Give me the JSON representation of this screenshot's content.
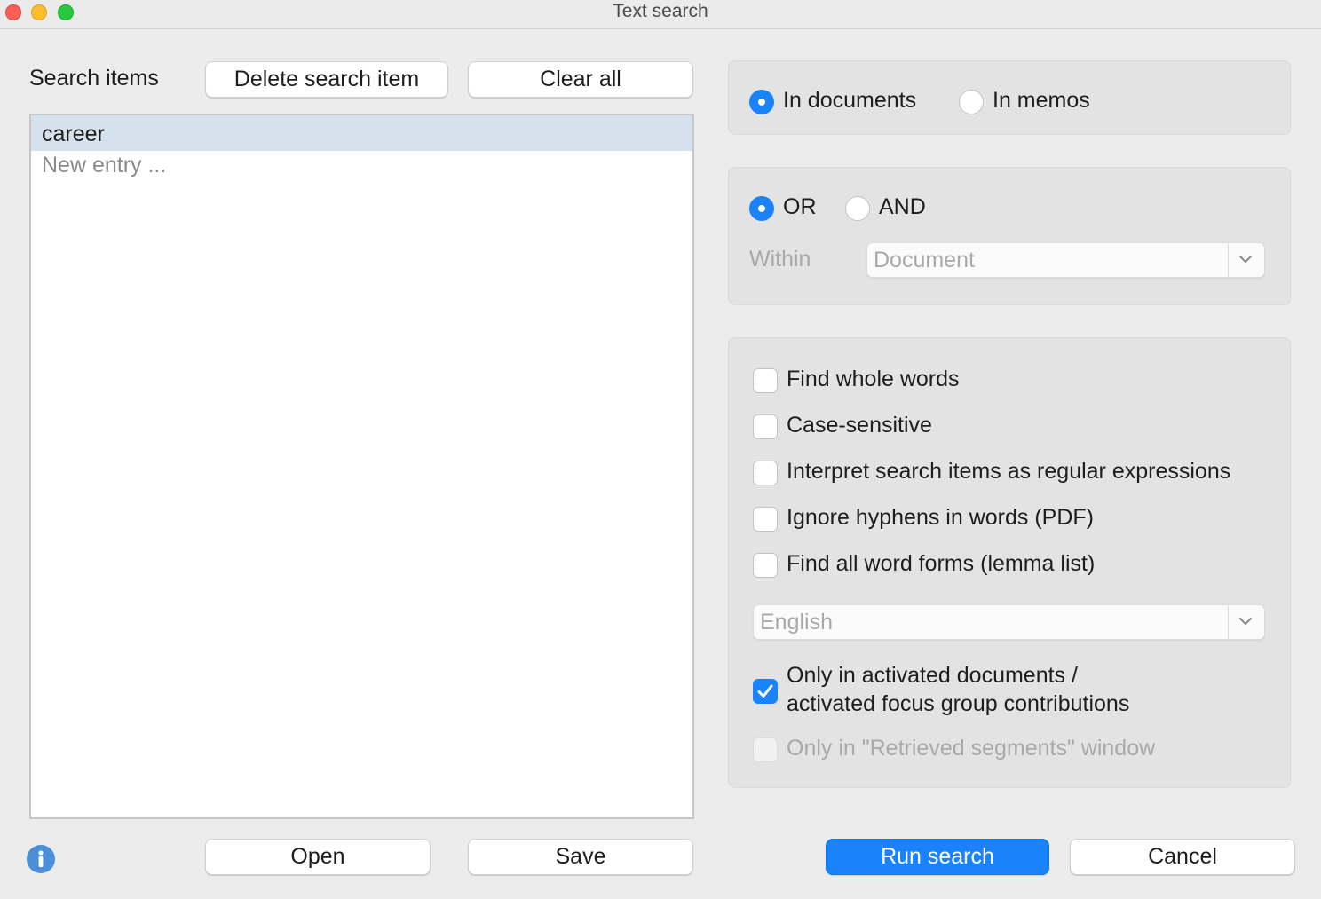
{
  "window": {
    "title": "Text search"
  },
  "search_items": {
    "label": "Search items",
    "delete_button": "Delete search item",
    "clear_button": "Clear all",
    "items": [
      "career"
    ],
    "new_entry_placeholder": "New entry ..."
  },
  "scope": {
    "in_documents": {
      "label": "In documents",
      "selected": true
    },
    "in_memos": {
      "label": "In memos",
      "selected": false
    }
  },
  "logic": {
    "or": {
      "label": "OR",
      "selected": true
    },
    "and": {
      "label": "AND",
      "selected": false
    },
    "within_label": "Within",
    "within_value": "Document"
  },
  "options": {
    "find_whole_words": {
      "label": "Find whole words",
      "checked": false
    },
    "case_sensitive": {
      "label": "Case-sensitive",
      "checked": false
    },
    "regex": {
      "label": "Interpret search items as regular expressions",
      "checked": false
    },
    "ignore_hyphens": {
      "label": "Ignore hyphens in words (PDF)",
      "checked": false
    },
    "word_forms": {
      "label": "Find all word forms (lemma list)",
      "checked": false
    },
    "language_value": "English",
    "only_activated": {
      "label_line1": "Only in activated documents /",
      "label_line2": "activated focus group contributions",
      "checked": true
    },
    "only_retrieved": {
      "label": "Only in \"Retrieved segments\" window",
      "checked": false,
      "disabled": true
    }
  },
  "footer": {
    "open_button": "Open",
    "save_button": "Save",
    "run_button": "Run search",
    "cancel_button": "Cancel"
  },
  "colors": {
    "accent": "#1a82fb",
    "selection": "#d5e1ec",
    "background": "#ececec"
  }
}
